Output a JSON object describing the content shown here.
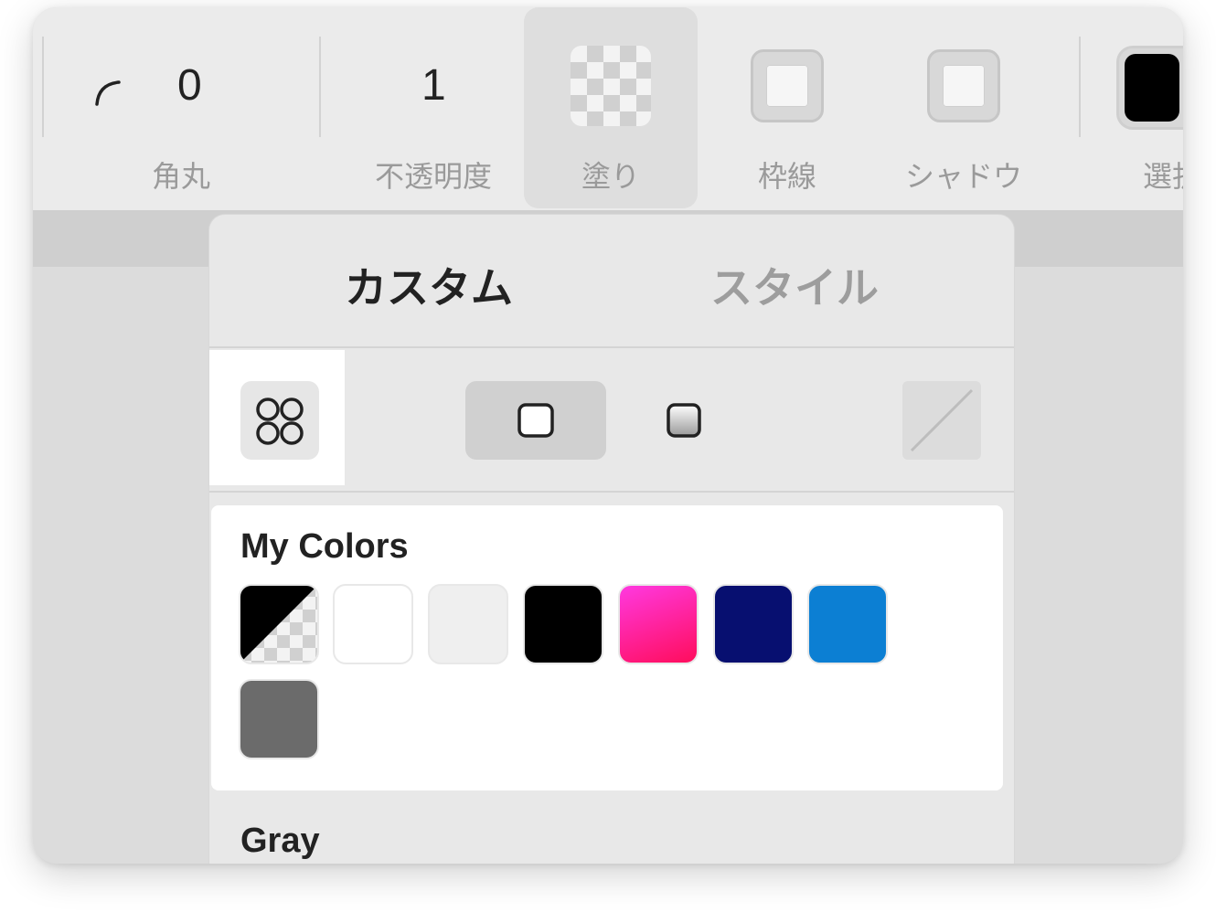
{
  "toolbar": {
    "corner": {
      "label": "角丸",
      "value": "0"
    },
    "opacity": {
      "label": "不透明度",
      "value": "1"
    },
    "fill": {
      "label": "塗り"
    },
    "stroke": {
      "label": "枠線"
    },
    "shadow": {
      "label": "シャドウ"
    },
    "select": {
      "label": "選択"
    }
  },
  "panel": {
    "tabs": [
      {
        "label": "カスタム",
        "active": true
      },
      {
        "label": "スタイル",
        "active": false
      }
    ],
    "sections": {
      "my_colors": {
        "title": "My Colors",
        "swatches": [
          {
            "name": "black-transparent",
            "color": "#000000"
          },
          {
            "name": "white",
            "color": "#ffffff"
          },
          {
            "name": "light-gray",
            "color": "#efefef"
          },
          {
            "name": "black",
            "color": "#000000"
          },
          {
            "name": "pink-gradient",
            "color": "#ff1b8d"
          },
          {
            "name": "navy",
            "color": "#070f70"
          },
          {
            "name": "blue",
            "color": "#0c7fd3"
          },
          {
            "name": "dark-gray",
            "color": "#6b6b6b"
          }
        ]
      },
      "gray": {
        "title": "Gray"
      }
    }
  },
  "colors": {
    "accent_blue": "#0c7fd3",
    "pink_start": "#ff39e0",
    "pink_end": "#ff0d5c"
  }
}
